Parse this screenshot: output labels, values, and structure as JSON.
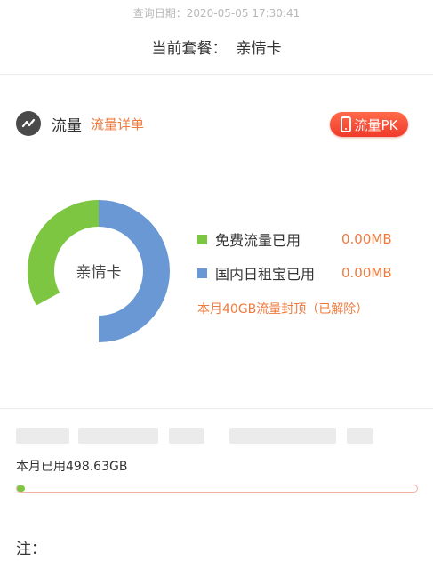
{
  "header": {
    "query_date": "查询日期：2020-05-05 17:30:41",
    "plan_prefix": "当前套餐：",
    "plan_name": "亲情卡"
  },
  "traffic": {
    "icon": "trend-line-icon",
    "title": "流量",
    "detail_link": "流量详单",
    "pk_button": "流量PK",
    "pk_icon": "phone-icon"
  },
  "chart_data": {
    "type": "pie",
    "center_label": "亲情卡",
    "series": [
      {
        "name": "免费流量已用",
        "value_text": "0.00MB",
        "share": 0.33,
        "color": "#7dc641"
      },
      {
        "name": "国内日租宝已用",
        "value_text": "0.00MB",
        "share": 0.5,
        "color": "#6a98d4"
      }
    ]
  },
  "cap_note": "本月40GB流量封顶（已解除）",
  "usage": {
    "label": "本月已用498.63GB",
    "progress_fraction": 0.02,
    "bar_color": "#7dc641"
  },
  "note": "注："
}
